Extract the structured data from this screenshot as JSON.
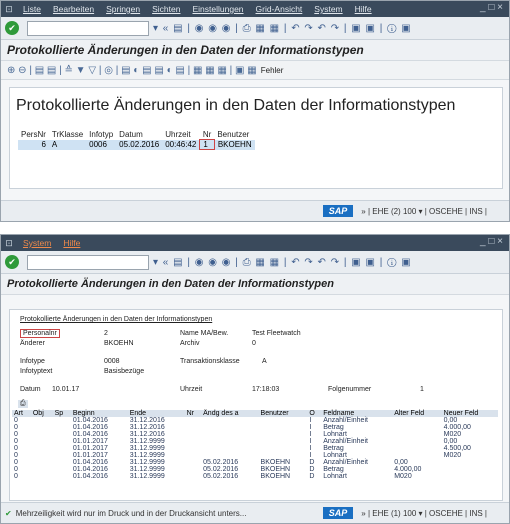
{
  "win1": {
    "menu": [
      "Liste",
      "Bearbeiten",
      "Springen",
      "Sichten",
      "Einstellungen",
      "Grid-Ansicht",
      "System",
      "Hilfe"
    ],
    "window_controls": "_ □ ×",
    "toolbar_icons": "▾ « ▤ | ◉ ◉ ◉ | ⎙ ▦ ▦ | ↶ ↷ ↶ ↷ | ▣ ▣ | ⓘ ▣",
    "title": "Protokollierte Änderungen in den Daten der Informationstypen",
    "app_toolbar_icons": "⊕ ⊖ | ▤ ▤ | ≙ ▼ ▽ | ◎ | ▤ ◐ ▤ ▤ ◐ ▤ | ▦ ▦ ▦ | ▣ ▦",
    "fehler_label": "Fehler",
    "big_title": "Protokollierte Änderungen in den Daten der Informationstypen",
    "table": {
      "headers": [
        "PersNr",
        "TrKlasse",
        "Infotyp",
        "Datum",
        "Uhrzeit",
        "Nr",
        "Benutzer"
      ],
      "rows": [
        [
          "6",
          "A",
          "0006",
          "05.02.2016",
          "00:46:42",
          "1",
          "BKOEHN"
        ]
      ]
    },
    "status": "» | EHE (2) 100 ▾ | OSCEHE | INS |"
  },
  "win2": {
    "menu": [
      "System",
      "Hilfe"
    ],
    "window_controls": "_ □ ×",
    "title": "Protokollierte Änderungen in den Daten der Informationstypen",
    "subtitle": "Protokollierte Änderungen in den Daten der Informationstypen",
    "fields": {
      "personalnr_label": "Personalnr",
      "personalnr_value": "2",
      "name_label": "Name MA/Bew.",
      "name_value": "Test Fleetwatch",
      "aenderer_label": "Änderer",
      "aenderer_value": "BKOEHN",
      "archiv_label": "Archiv",
      "archiv_value": "0",
      "infotype_label": "Infotype",
      "infotype_value": "0008",
      "transaktionsklasse_label": "Transaktionsklasse",
      "transaktionsklasse_value": "A",
      "infotyptext_label": "Infotyptext",
      "infotyptext_value": "Basisbezüge",
      "datum_label": "Datum",
      "datum_value": "10.01.17",
      "uhrzeit_label": "Uhrzeit",
      "uhrzeit_value": "17:18:03",
      "folgenummer_label": "Folgenummer",
      "folgenummer_value": "1"
    },
    "table": {
      "headers": [
        "Art",
        "Obj",
        "Sp",
        "Beginn",
        "Ende",
        "Nr",
        "Ändg des a",
        "Benutzer",
        "O",
        "Feldname",
        "Alter Feld",
        "Neuer Feld"
      ],
      "rows": [
        [
          "0",
          "",
          "",
          "01.04.2016",
          "31.12.2016",
          "",
          "",
          "",
          "I",
          "Anzahl/Einheit",
          "",
          "0,00"
        ],
        [
          "0",
          "",
          "",
          "01.04.2016",
          "31.12.2016",
          "",
          "",
          "",
          "I",
          "Betrag",
          "",
          "4.000,00"
        ],
        [
          "0",
          "",
          "",
          "01.04.2016",
          "31.12.2016",
          "",
          "",
          "",
          "I",
          "Lohnart",
          "",
          "M020"
        ],
        [
          "0",
          "",
          "",
          "01.01.2017",
          "31.12.9999",
          "",
          "",
          "",
          "I",
          "Anzahl/Einheit",
          "",
          "0,00"
        ],
        [
          "0",
          "",
          "",
          "01.01.2017",
          "31.12.9999",
          "",
          "",
          "",
          "I",
          "Betrag",
          "",
          "4.500,00"
        ],
        [
          "0",
          "",
          "",
          "01.01.2017",
          "31.12.9999",
          "",
          "",
          "",
          "I",
          "Lohnart",
          "",
          "M020"
        ],
        [
          "0",
          "",
          "",
          "01.04.2016",
          "31.12.9999",
          "",
          "05.02.2016",
          "BKOEHN",
          "D",
          "Anzahl/Einheit",
          "0,00",
          ""
        ],
        [
          "0",
          "",
          "",
          "01.04.2016",
          "31.12.9999",
          "",
          "05.02.2016",
          "BKOEHN",
          "D",
          "Betrag",
          "4.000,00",
          ""
        ],
        [
          "0",
          "",
          "",
          "01.04.2016",
          "31.12.9999",
          "",
          "05.02.2016",
          "BKOEHN",
          "D",
          "Lohnart",
          "M020",
          ""
        ]
      ]
    },
    "status_msg": "Mehrzeiligkeit wird nur im Druck und in der Druckansicht unters...",
    "status": "» | EHE (1) 100 ▾ | OSCEHE | INS |"
  },
  "sap_logo": "SAP"
}
